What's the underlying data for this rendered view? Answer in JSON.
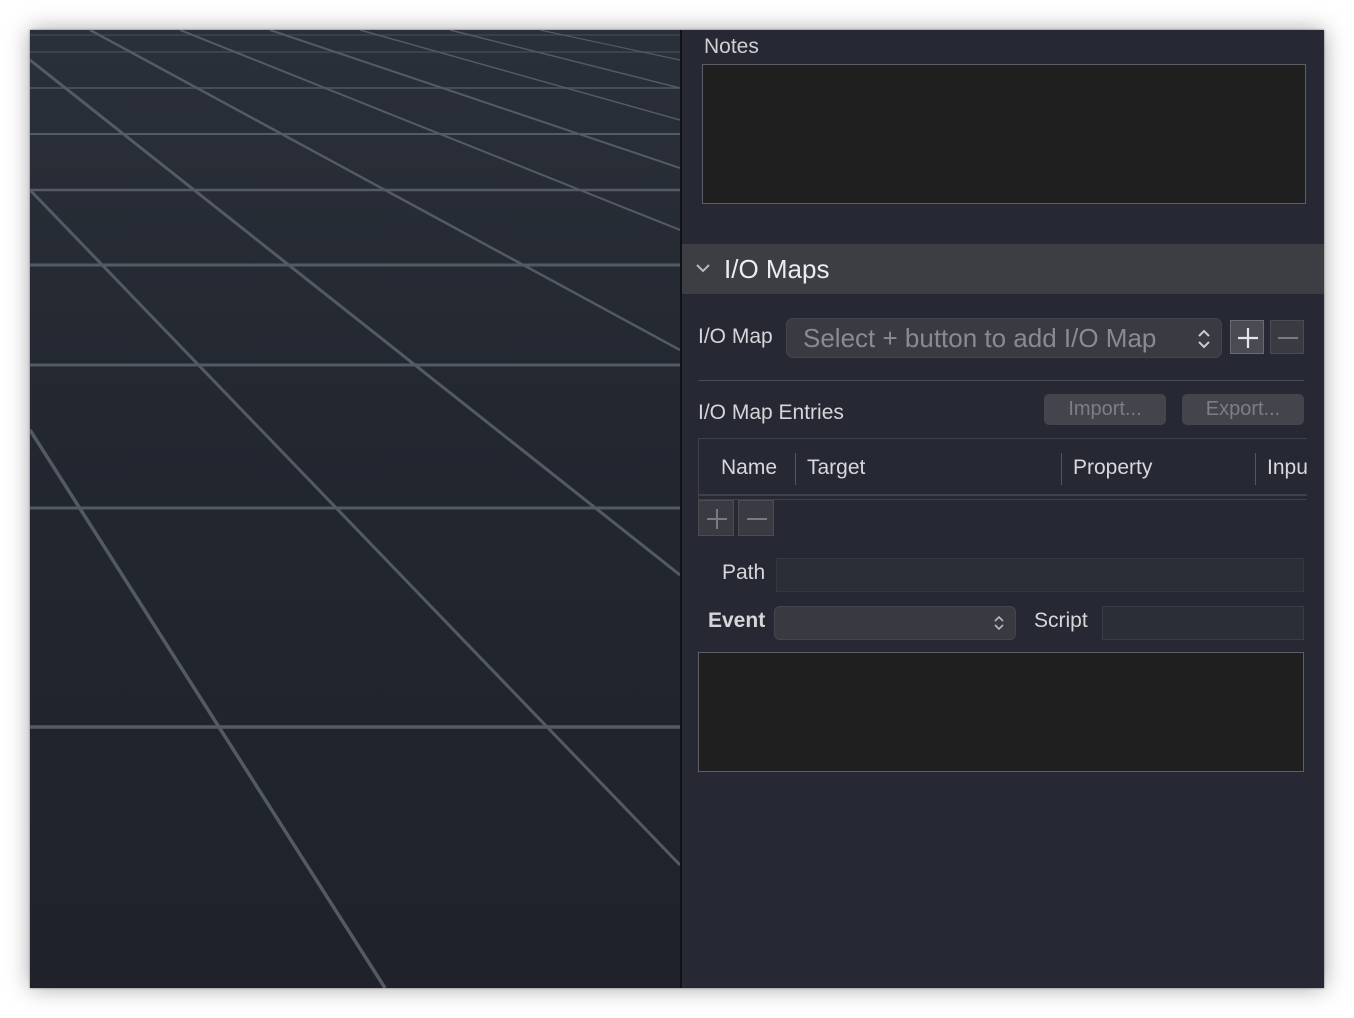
{
  "notes": {
    "label": "Notes",
    "value": ""
  },
  "io_maps": {
    "title": "I/O Maps",
    "map_label": "I/O Map",
    "map_placeholder": "Select + button to add I/O Map",
    "entries_label": "I/O Map Entries",
    "import_label": "Import...",
    "export_label": "Export...",
    "columns": [
      "Name",
      "Target",
      "Property",
      "Inpu"
    ],
    "path_label": "Path",
    "path_value": "",
    "event_label": "Event",
    "event_value": "",
    "script_label": "Script",
    "script_value": ""
  },
  "icons": {
    "section_toggle": "chevron-down-icon",
    "map_add": "plus-icon",
    "map_remove": "minus-icon",
    "entry_add": "plus-icon",
    "entry_remove": "minus-icon",
    "select_arrows": "up-down-arrows-icon"
  }
}
